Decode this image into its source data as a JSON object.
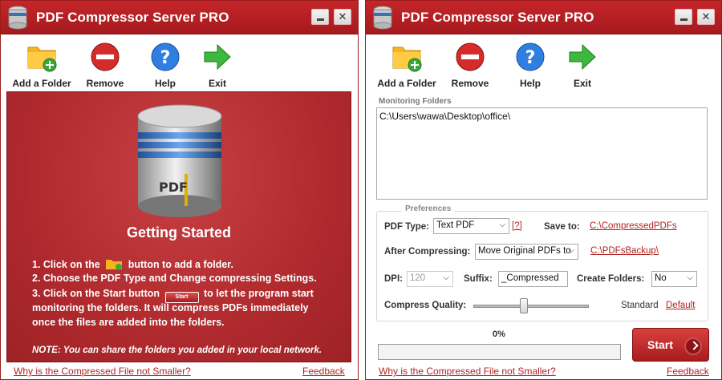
{
  "window_title": "PDF Compressor Server PRO",
  "toolbar": {
    "add_folder": "Add a Folder",
    "remove": "Remove",
    "help": "Help",
    "exit": "Exit"
  },
  "left": {
    "heading": "Getting Started",
    "step1_a": "1. Click on the",
    "step1_b": "button to add a folder.",
    "step2": "2. Choose the PDF Type and Change compressing Settings.",
    "step3_a": "3. Click on the Start button",
    "step3_b": "to let the program start",
    "step3_c": "monitoring the folders. It will compress PDFs immediately",
    "step3_d": "once the files are added into the folders.",
    "start_mini": "Start",
    "db_label": "PDF",
    "note": "NOTE: You can share the folders you added in your local network."
  },
  "footer": {
    "why_link": "Why is the Compressed File not Smaller?",
    "feedback": "Feedback"
  },
  "right": {
    "monitoring_label": "Monitoring Folders",
    "folders": [
      "C:\\Users\\wawa\\Desktop\\office\\"
    ],
    "prefs_title": "Preferences",
    "pdf_type_label": "PDF Type:",
    "pdf_type_value": "Text PDF",
    "help_link": "[?]",
    "save_to_label": "Save to:",
    "save_to_path": "C:\\CompressedPDFs",
    "after_label": "After Compressing:",
    "after_value": "Move Original PDFs to",
    "backup_path": "C:\\PDFsBackup\\",
    "dpi_label": "DPI:",
    "dpi_value": "120",
    "suffix_label": "Suffix:",
    "suffix_value": "_Compressed",
    "create_label": "Create Folders:",
    "create_value": "No",
    "quality_label": "Compress Quality:",
    "quality_level": 0.44,
    "quality_text": "Standard",
    "default_link": "Default",
    "progress_text": "0%",
    "progress": 0,
    "start_label": "Start"
  },
  "colors": {
    "brand_red": "#b02a2e",
    "link_red": "#b22222"
  }
}
